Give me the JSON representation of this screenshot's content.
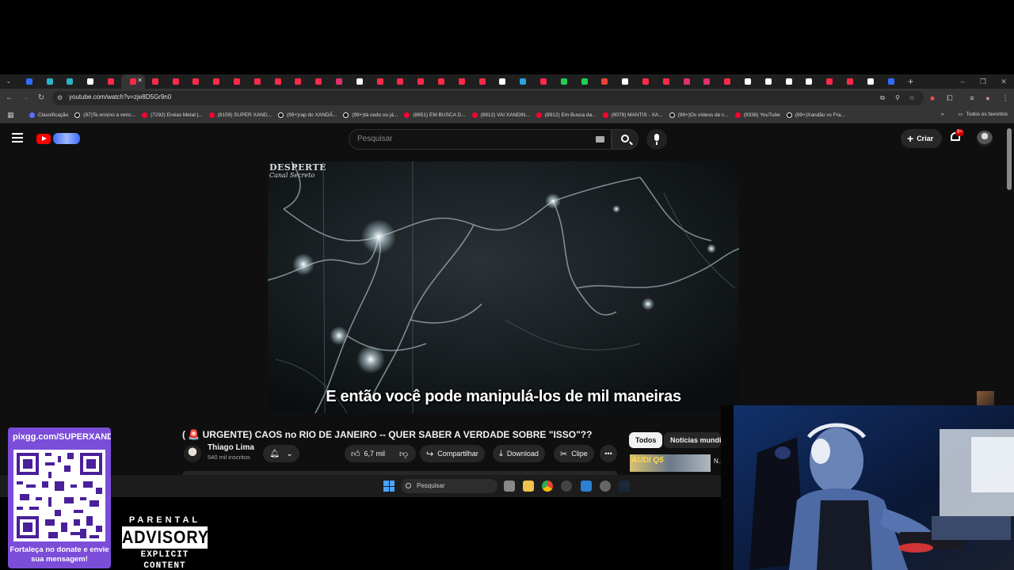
{
  "browser": {
    "tabs_count": 43,
    "active_tab_index": 5,
    "url": "youtube.com/watch?v=zje8D5Gr9n0",
    "bookmarks": [
      {
        "label": "Classificação",
        "color": "#5b6cff"
      },
      {
        "label": "(97)Te ensino a venc...",
        "color": "#111111"
      },
      {
        "label": "(7292) Enéas Metal |...",
        "color": "#ff0033"
      },
      {
        "label": "(8159) SUPER XAND...",
        "color": "#ff0033"
      },
      {
        "label": "(99+)rap do XANDÃ...",
        "color": "#111111"
      },
      {
        "label": "(99+)tá cedo ou já...",
        "color": "#111111"
      },
      {
        "label": "(8851) EM BUSCA D...",
        "color": "#ff0033"
      },
      {
        "label": "(8912) VAI XANDIN...",
        "color": "#ff0033"
      },
      {
        "label": "(8912) Em Busca da...",
        "color": "#ff0033"
      },
      {
        "label": "(9078) MANTIS - XA...",
        "color": "#ff0033"
      },
      {
        "label": "(99+)Os vídeos de c...",
        "color": "#111111"
      },
      {
        "label": "(9338) YouTube",
        "color": "#ff0033"
      },
      {
        "label": "(99+)Xandão vs Fra...",
        "color": "#111111"
      }
    ],
    "all_bookmarks": "Todos os favoritos"
  },
  "youtube": {
    "search_placeholder": "Pesquisar",
    "create_label": "Criar",
    "notifications": "9+",
    "video": {
      "watermark_line1": "DESPERTE",
      "watermark_line2": "Canal Secreto",
      "subtitle": "E então você pode manipulá-los de mil maneiras"
    },
    "title_emoji": "🚨",
    "title": "( 🚨 URGENTE) CAOS no RIO DE JANEIRO -- QUER SABER A VERDADE SOBRE \"ISSO\"??",
    "channel": "Thiago Lima",
    "subscribers": "540 mil inscritos",
    "likes": "6,7 mil",
    "share_label": "Compartilhar",
    "download_label": "Download",
    "clip_label": "Clipe",
    "chips": [
      "Todos",
      "Notícias mundiais"
    ],
    "rec_thumb_text": "AUDI Q5",
    "rec_title": "N..."
  },
  "taskbar": {
    "search_placeholder": "Pesquisar"
  },
  "overlay": {
    "qr_url": "pixgg.com/SUPERXANDÃO",
    "qr_message": "Fortaleça no donate e envie sua mensagem!",
    "advisory_top": "PARENTAL",
    "advisory_mid": "ADVISORY",
    "advisory_bot": "EXPLICIT CONTENT"
  }
}
